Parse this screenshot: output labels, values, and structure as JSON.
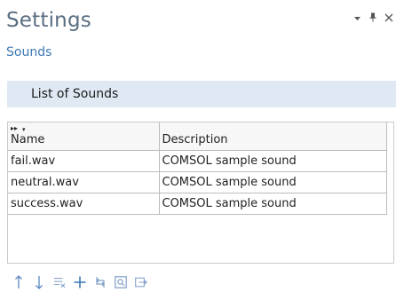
{
  "panel": {
    "title": "Settings",
    "subtitle": "Sounds"
  },
  "window_controls": {
    "dropdown_glyph": "▾",
    "pin_glyph": "⊥",
    "close_glyph": "×"
  },
  "section": {
    "title": "List of Sounds"
  },
  "table": {
    "columns": [
      "Name",
      "Description"
    ],
    "rows": [
      {
        "name": "fail.wav",
        "description": "COMSOL sample sound"
      },
      {
        "name": "neutral.wav",
        "description": "COMSOL sample sound"
      },
      {
        "name": "success.wav",
        "description": "COMSOL sample sound"
      }
    ]
  },
  "toolbar": {
    "icons": [
      "move-up-icon",
      "move-down-icon",
      "clear-table-icon",
      "add-icon",
      "replace-icon",
      "preview-icon",
      "import-icon"
    ]
  },
  "colors": {
    "title": "#5a6e82",
    "subtitle": "#3b79b5",
    "section_bg": "#dfe8f3",
    "icon_blue": "#4f86c6"
  }
}
